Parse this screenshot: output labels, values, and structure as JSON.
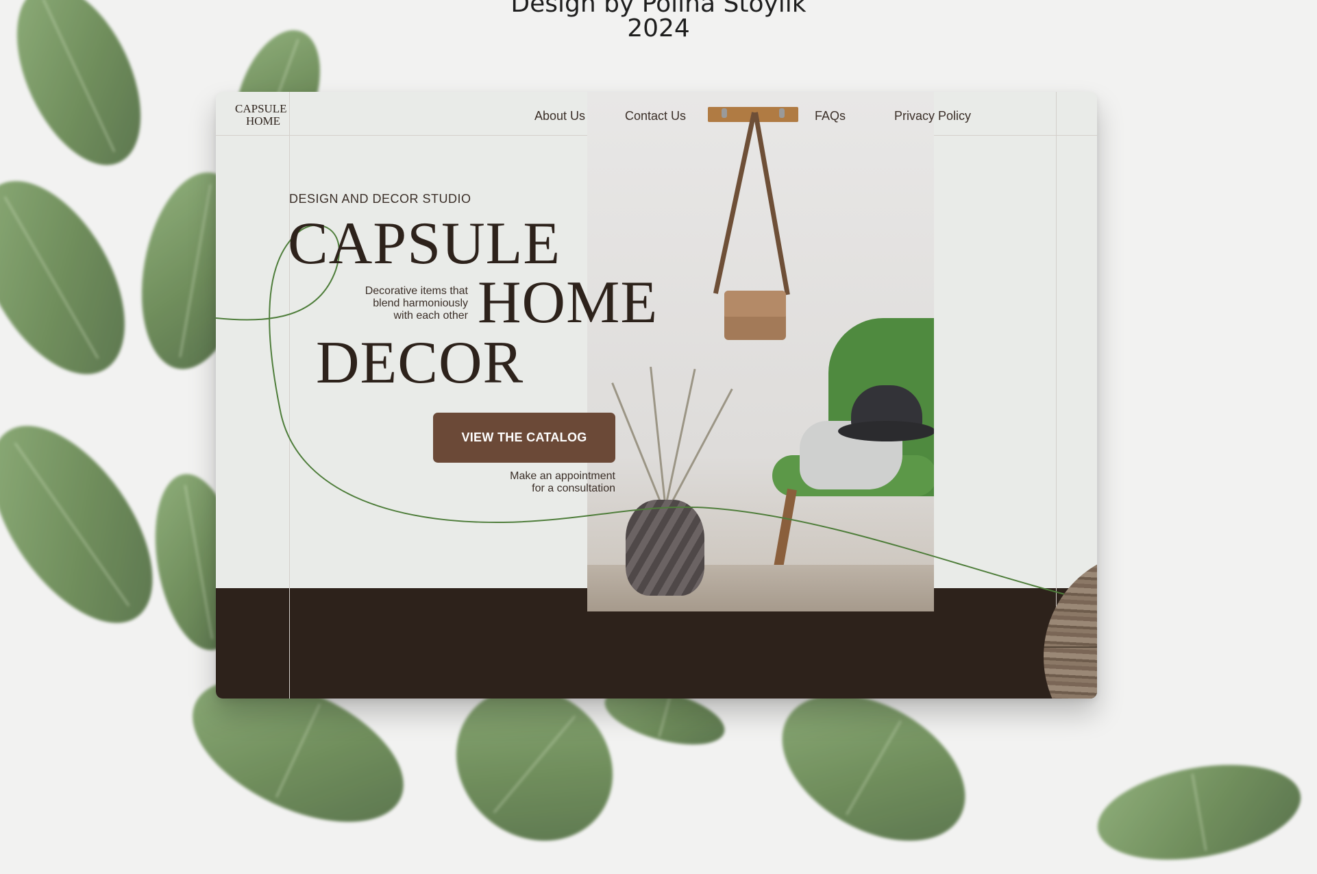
{
  "page": {
    "caption_line1": "Design by Polina Stoylik",
    "caption_line2": "2024"
  },
  "brand": {
    "logo_line1": "CAPSULE",
    "logo_line2": "HOME"
  },
  "nav": {
    "items": [
      {
        "label": "About Us"
      },
      {
        "label": "Contact Us"
      },
      {
        "label": "FAQs"
      },
      {
        "label": "Privacy Policy"
      }
    ]
  },
  "hero": {
    "subheading": "DESIGN AND DECOR STUDIO",
    "title_line1": "CAPSULE",
    "title_line2": "HOME",
    "title_line3": "DECOR",
    "tagline_line1": "Decorative items that",
    "tagline_line2": "blend harmoniously",
    "tagline_line3": "with each other",
    "cta_label": "VIEW THE CATALOG",
    "appointment_line1": "Make an appointment",
    "appointment_line2": "for a consultation"
  },
  "colors": {
    "card_background": "#e9ebe8",
    "footer_band": "#2d221b",
    "button": "#6b4937",
    "curve_green": "#4e7d3a",
    "text_dark": "#2d221b"
  },
  "icons": [
    "leaf-decoration",
    "wood-texture-circle",
    "interior-photo"
  ]
}
